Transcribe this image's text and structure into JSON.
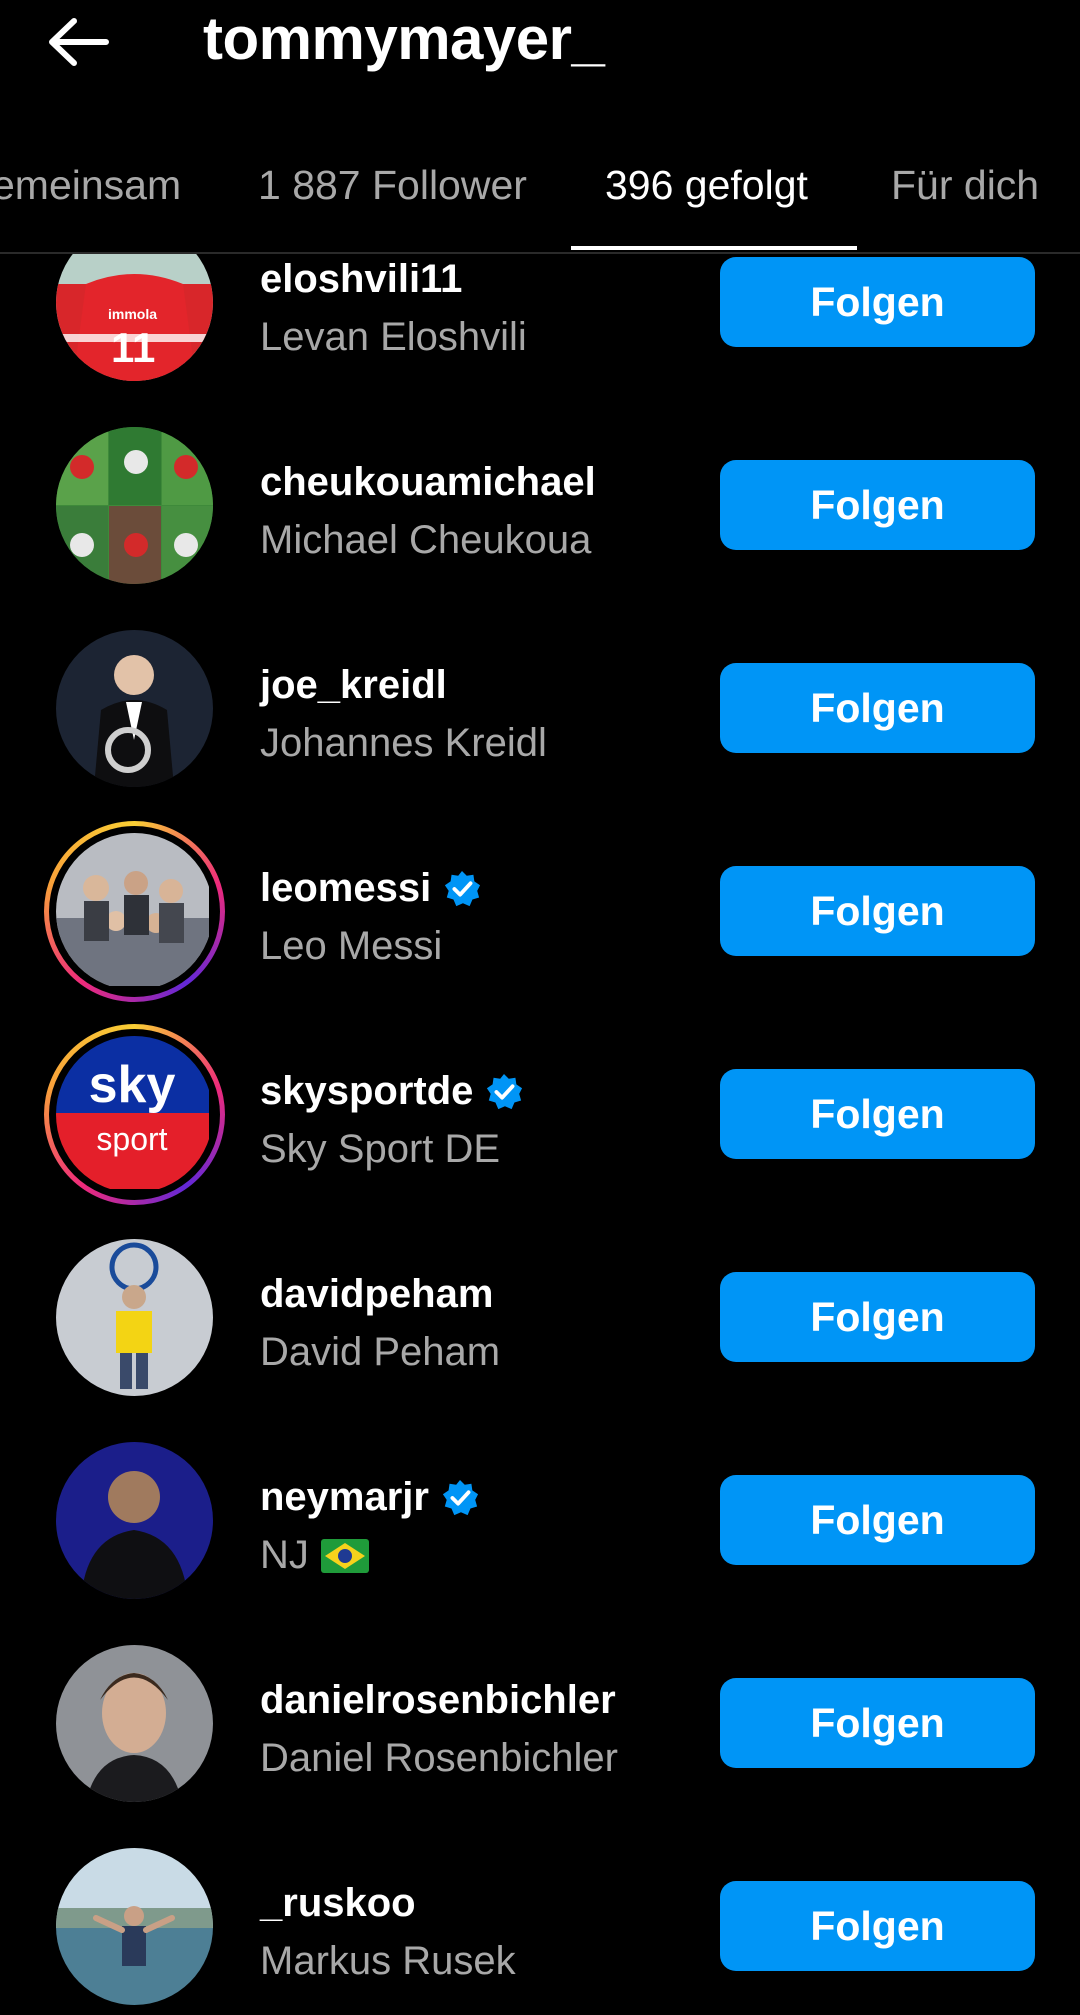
{
  "header": {
    "title": "tommymayer_",
    "back_icon": "arrow-left-icon"
  },
  "tabs": [
    {
      "label": "emeinsam",
      "active": false
    },
    {
      "label": "1 887 Follower",
      "active": false
    },
    {
      "label": "396 gefolgt",
      "active": true
    },
    {
      "label": "Für dich",
      "active": false
    }
  ],
  "follow_label": "Folgen",
  "accounts": [
    {
      "username": "eloshvili11",
      "name": "Levan Eloshvili",
      "verified": false,
      "story_ring": false
    },
    {
      "username": "cheukouamichael",
      "name": "Michael Cheukoua",
      "verified": false,
      "story_ring": false
    },
    {
      "username": "joe_kreidl",
      "name": "Johannes Kreidl",
      "verified": false,
      "story_ring": false
    },
    {
      "username": "leomessi",
      "name": "Leo Messi",
      "verified": true,
      "story_ring": true
    },
    {
      "username": "skysportde",
      "name": "Sky Sport DE",
      "verified": true,
      "story_ring": true
    },
    {
      "username": "davidpeham",
      "name": "David Peham",
      "verified": false,
      "story_ring": false
    },
    {
      "username": "neymarjr",
      "name": "NJ",
      "verified": true,
      "story_ring": false,
      "name_flag": "brazil-flag-icon"
    },
    {
      "username": "danielrosenbichler",
      "name": "Daniel Rosenbichler",
      "verified": false,
      "story_ring": false
    },
    {
      "username": "_ruskoo",
      "name": "Markus Rusek",
      "verified": false,
      "story_ring": false
    }
  ],
  "avatar_texts": {
    "eloshvili_shirt": "11",
    "eloshvili_sponsor": "immola",
    "sky_logo_top": "sky",
    "sky_logo_bottom": "sport"
  },
  "colors": {
    "background": "#000000",
    "button": "#0095f6",
    "secondary_text": "#a8a8a8",
    "verified": "#0095f6"
  }
}
